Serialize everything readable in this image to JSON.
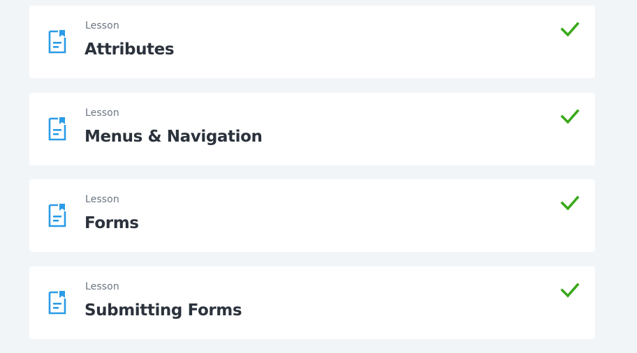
{
  "lessons": [
    {
      "type": "Lesson",
      "title": "Attributes",
      "completed": true
    },
    {
      "type": "Lesson",
      "title": "Menus & Navigation",
      "completed": true
    },
    {
      "type": "Lesson",
      "title": "Forms",
      "completed": true
    },
    {
      "type": "Lesson",
      "title": "Submitting Forms",
      "completed": true
    }
  ],
  "icons": {
    "lesson": "document-icon",
    "completed": "checkmark-icon"
  },
  "colors": {
    "page_background": "#f2f5f8",
    "card_background": "#ffffff",
    "icon_blue": "#2a9be6",
    "check_green": "#3aa81a",
    "title_text": "#2b323c",
    "label_text": "#6a7482"
  }
}
